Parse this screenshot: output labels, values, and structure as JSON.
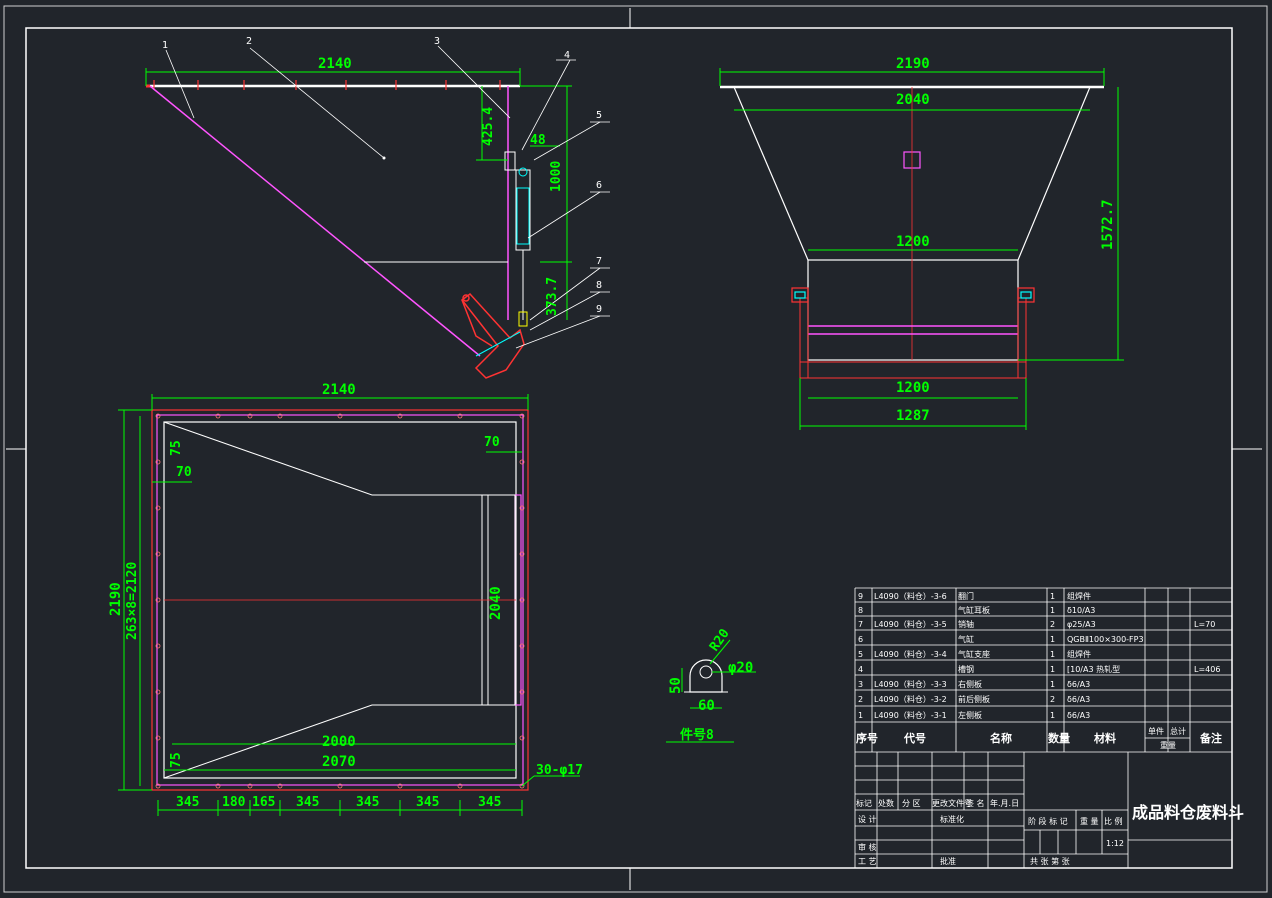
{
  "drawing": {
    "title": "成品料仓废料斗",
    "scale": "1:12",
    "detail_caption": "件号8",
    "hole_note": "30-φ17"
  },
  "front_view": {
    "dims": {
      "width": "2140",
      "d_425": "425.4",
      "d_48": "48",
      "d_1000": "1000",
      "d_373": "373.7"
    },
    "leaders": [
      "1",
      "2",
      "3",
      "4",
      "5",
      "6",
      "7",
      "8",
      "9"
    ]
  },
  "side_view": {
    "dims": {
      "top": "2190",
      "second": "2040",
      "mid": "1200",
      "height": "1572.7",
      "bottom": "1200",
      "base": "1287"
    }
  },
  "plan_view": {
    "dims": {
      "width": "2140",
      "height": "2190",
      "holes_v": "263×8=2120",
      "inner": "2040",
      "d_75a": "75",
      "d_70a": "70",
      "d_70b": "70",
      "d_75b": "75",
      "d_2000": "2000",
      "d_2070": "2070",
      "b1": "345",
      "b2": "180",
      "b3": "165",
      "b4": "345",
      "b5": "345",
      "b6": "345",
      "b7": "345"
    }
  },
  "detail": {
    "r": "R20",
    "phi": "φ20",
    "h": "50",
    "w": "60"
  },
  "bom": {
    "rows": [
      {
        "no": "9",
        "code": "L4090（料仓）-3-6",
        "name": "翻门",
        "qty": "1",
        "mat": "组焊件",
        "note": ""
      },
      {
        "no": "8",
        "code": "",
        "name": "气缸耳板",
        "qty": "1",
        "mat": "δ10/A3",
        "note": ""
      },
      {
        "no": "7",
        "code": "L4090（料仓）-3-5",
        "name": "销轴",
        "qty": "2",
        "mat": "φ25/A3",
        "note": "L=70"
      },
      {
        "no": "6",
        "code": "",
        "name": "气缸",
        "qty": "1",
        "mat": "QGBⅡ100×300-FP3",
        "note": ""
      },
      {
        "no": "5",
        "code": "L4090（料仓）-3-4",
        "name": "气缸支座",
        "qty": "1",
        "mat": "组焊件",
        "note": ""
      },
      {
        "no": "4",
        "code": "",
        "name": "槽钢",
        "qty": "1",
        "mat": "[10/A3  热轧型",
        "note": "L=406"
      },
      {
        "no": "3",
        "code": "L4090（料仓）-3-3",
        "name": "右侧板",
        "qty": "1",
        "mat": "δ6/A3",
        "note": ""
      },
      {
        "no": "2",
        "code": "L4090（料仓）-3-2",
        "name": "前后侧板",
        "qty": "2",
        "mat": "δ6/A3",
        "note": ""
      },
      {
        "no": "1",
        "code": "L4090（料仓）-3-1",
        "name": "左侧板",
        "qty": "1",
        "mat": "δ6/A3",
        "note": ""
      }
    ],
    "header": {
      "no": "序号",
      "code": "代号",
      "name": "名称",
      "qty": "数量",
      "mat": "材料",
      "unit": "单件",
      "total": "总计",
      "weight": "重量",
      "note": "备注"
    }
  },
  "titleblock": {
    "rev_labels": [
      "标记",
      "处数",
      "分 区",
      "更改文件号",
      "签 名",
      "年.月.日"
    ],
    "design": "设 计",
    "std": "标准化",
    "check": "审 核",
    "process": "工 艺",
    "approve": "批准",
    "stage": "阶 段 标 记",
    "weight": "重 量",
    "ratio": "比 例",
    "sheets": "共     张  第     张"
  }
}
